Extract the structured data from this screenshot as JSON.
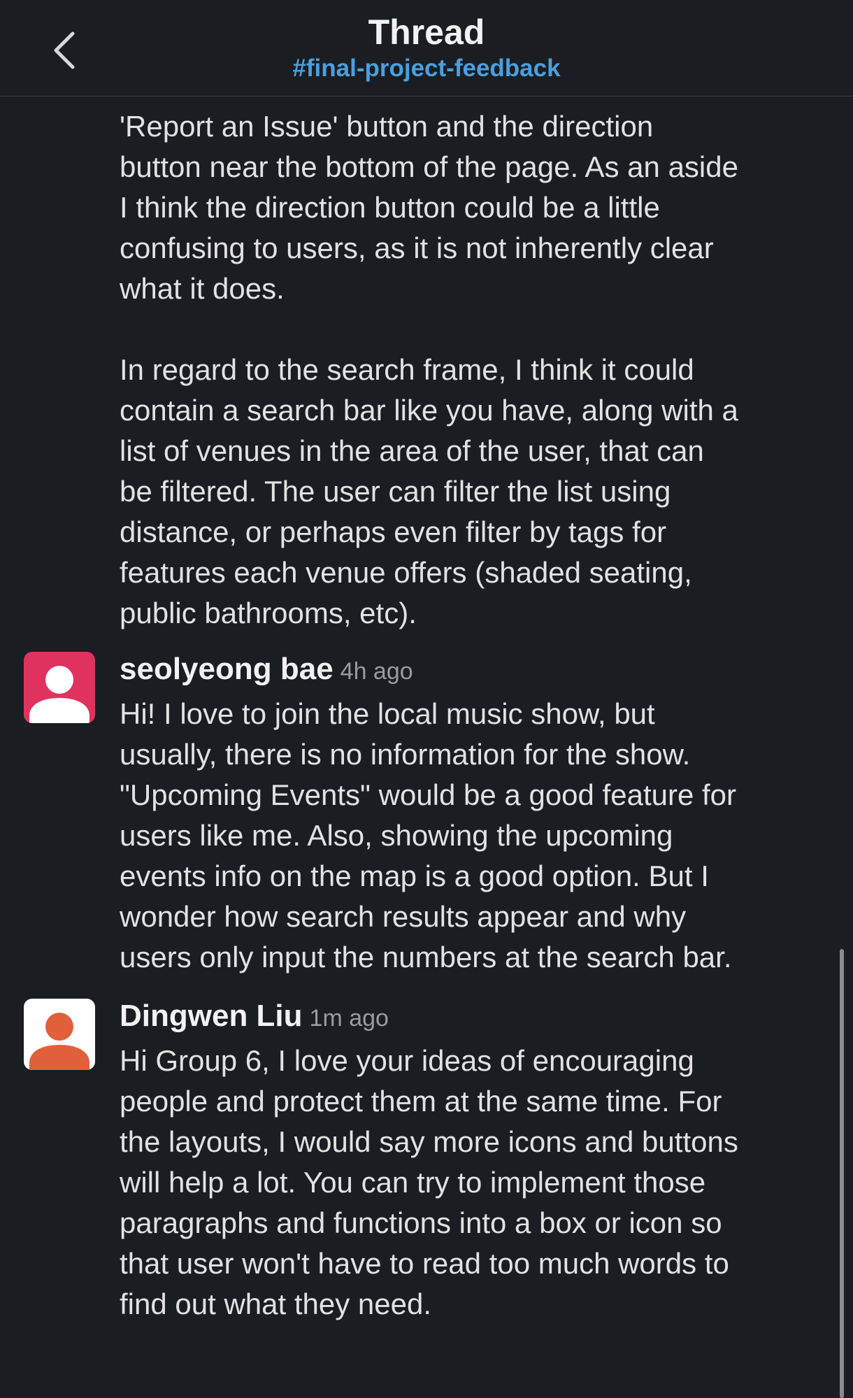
{
  "header": {
    "title": "Thread",
    "channel": "#final-project-feedback"
  },
  "messages": [
    {
      "text_1": "'Report an Issue' button and the direction\nbutton near the bottom of the page. As an aside\nI think the direction button could be a little\nconfusing to users, as it is not inherently clear\nwhat it does.",
      "text_2": "In regard to the search frame, I think it could\ncontain a search bar like you have, along with a\nlist of venues in the area of the user, that can\nbe filtered. The user can filter the list using\ndistance, or perhaps even filter by tags for\nfeatures each venue offers (shaded seating,\npublic bathrooms, etc)."
    },
    {
      "author": "seolyeong bae",
      "time": "4h ago",
      "avatar_color": "#e0325f",
      "text": "Hi! I love to join the local music show, but\nusually, there is no information for the show.\n\"Upcoming Events\" would be a good feature for\nusers like me. Also, showing the upcoming\nevents info on the map is a good option. But I\nwonder how search results appear and why\nusers only input the numbers at the search bar."
    },
    {
      "author": "Dingwen Liu",
      "time": "1m ago",
      "avatar_color": "#e0603a",
      "text": "Hi Group 6, I love your ideas of encouraging\npeople and protect them at the same time. For\nthe layouts, I would say more icons and buttons\nwill help a lot. You can try to implement those\nparagraphs and functions into a box or icon so\nthat user won't have to read too much words to\nfind out what they need."
    }
  ],
  "icons": {
    "back": "chevron-left-icon",
    "avatar": "user-silhouette-icon"
  }
}
